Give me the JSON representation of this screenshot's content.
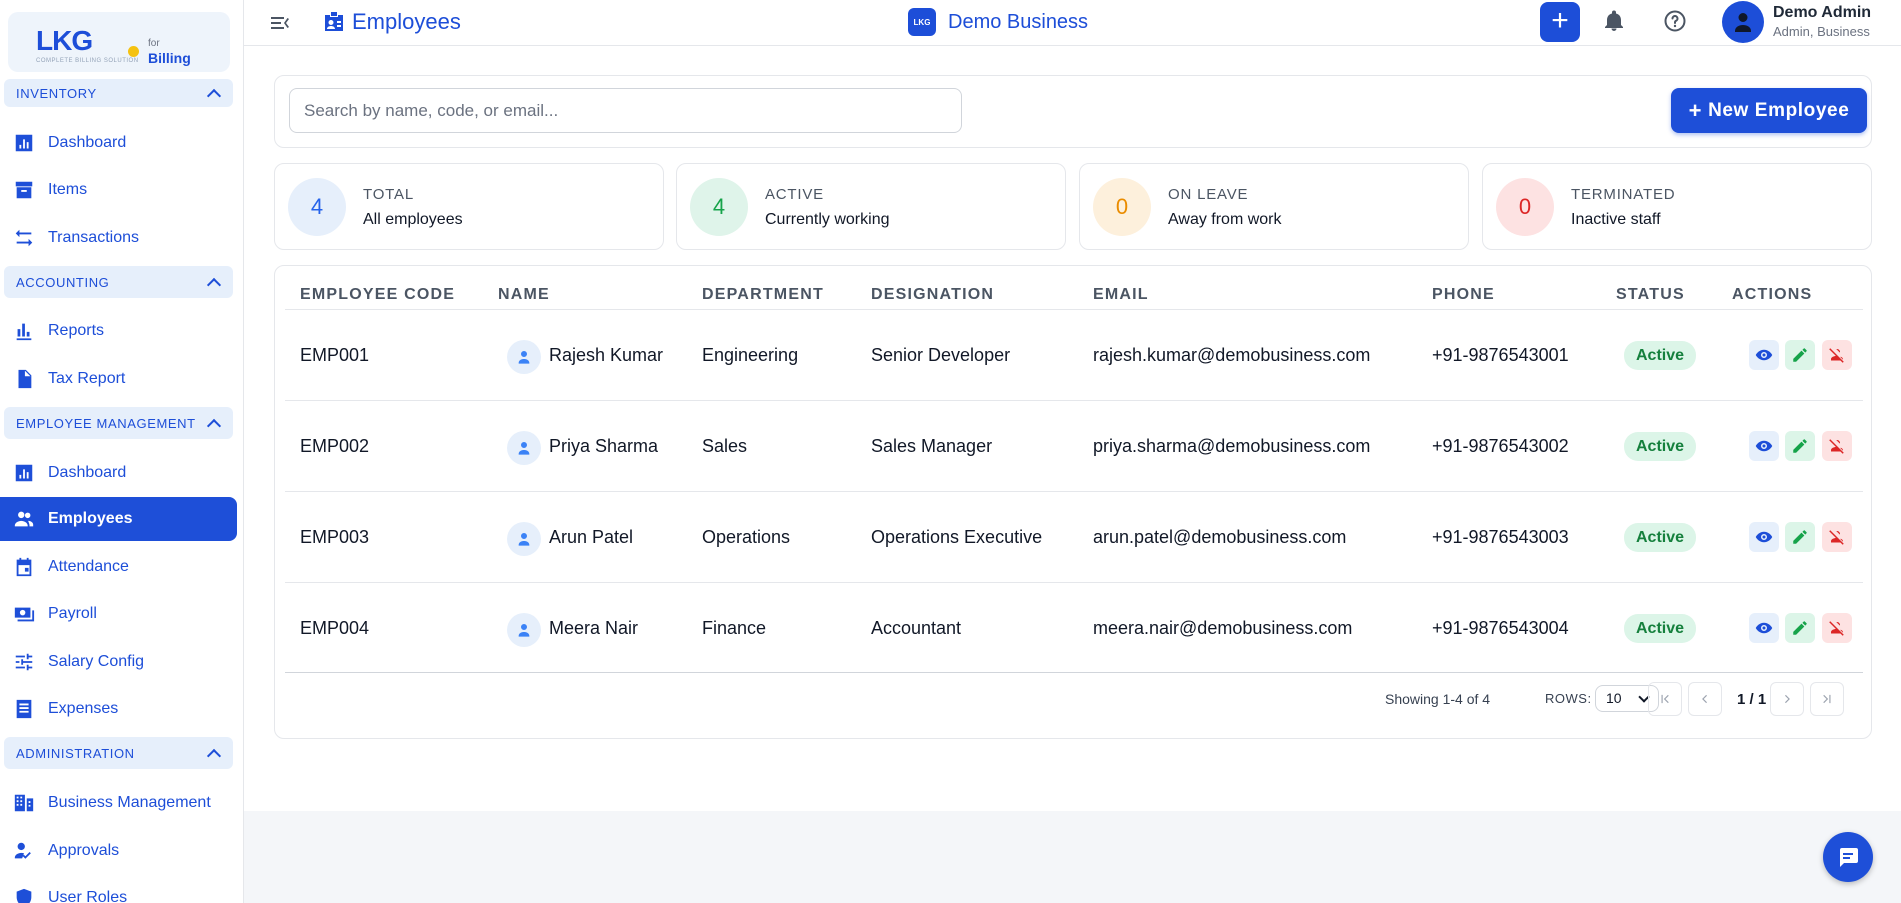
{
  "brand": {
    "logo_text": "LKG",
    "tagline": "COMPLETE BILLING SOLUTION",
    "for": "for",
    "product": "Billing"
  },
  "sidebar": {
    "sections": [
      {
        "label": "INVENTORY"
      },
      {
        "label": "ACCOUNTING"
      },
      {
        "label": "EMPLOYEE MANAGEMENT"
      },
      {
        "label": "ADMINISTRATION"
      }
    ],
    "items": [
      {
        "label": "Dashboard",
        "icon": "chart-icon"
      },
      {
        "label": "Items",
        "icon": "archive-icon"
      },
      {
        "label": "Transactions",
        "icon": "swap-icon"
      },
      {
        "label": "Reports",
        "icon": "bar-chart-icon"
      },
      {
        "label": "Tax Report",
        "icon": "document-icon"
      },
      {
        "label": "Dashboard",
        "icon": "dashboard-icon"
      },
      {
        "label": "Employees",
        "icon": "people-icon",
        "active": true
      },
      {
        "label": "Attendance",
        "icon": "calendar-icon"
      },
      {
        "label": "Payroll",
        "icon": "payments-icon"
      },
      {
        "label": "Salary Config",
        "icon": "tune-icon"
      },
      {
        "label": "Expenses",
        "icon": "receipt-icon"
      },
      {
        "label": "Business Management",
        "icon": "building-icon"
      },
      {
        "label": "Approvals",
        "icon": "approval-icon"
      },
      {
        "label": "User Roles",
        "icon": "shield-icon"
      }
    ]
  },
  "header": {
    "title": "Employees",
    "business_logo": "LKG",
    "business_name": "Demo Business",
    "add_label": "+",
    "user_name": "Demo Admin",
    "user_role": "Admin, Business"
  },
  "search": {
    "placeholder": "Search by name, code, or email...",
    "value": ""
  },
  "new_employee_button": {
    "plus": "+",
    "label": "New Employee"
  },
  "stats": [
    {
      "value": "4",
      "label": "TOTAL",
      "sub": "All employees",
      "color": "#2563eb",
      "bg": "#e6effb"
    },
    {
      "value": "4",
      "label": "ACTIVE",
      "sub": "Currently working",
      "color": "#16a34a",
      "bg": "#dff4ea"
    },
    {
      "value": "0",
      "label": "ON LEAVE",
      "sub": "Away from work",
      "color": "#ea8c00",
      "bg": "#fdf0dc"
    },
    {
      "value": "0",
      "label": "TERMINATED",
      "sub": "Inactive staff",
      "color": "#dc2626",
      "bg": "#fde2e2"
    }
  ],
  "table": {
    "headers": [
      "EMPLOYEE CODE",
      "NAME",
      "DEPARTMENT",
      "DESIGNATION",
      "EMAIL",
      "PHONE",
      "STATUS",
      "ACTIONS"
    ],
    "rows": [
      {
        "code": "EMP001",
        "name": "Rajesh Kumar",
        "department": "Engineering",
        "designation": "Senior Developer",
        "email": "rajesh.kumar@demobusiness.com",
        "phone": "+91-9876543001",
        "status": "Active"
      },
      {
        "code": "EMP002",
        "name": "Priya Sharma",
        "department": "Sales",
        "designation": "Sales Manager",
        "email": "priya.sharma@demobusiness.com",
        "phone": "+91-9876543002",
        "status": "Active"
      },
      {
        "code": "EMP003",
        "name": "Arun Patel",
        "department": "Operations",
        "designation": "Operations Executive",
        "email": "arun.patel@demobusiness.com",
        "phone": "+91-9876543003",
        "status": "Active"
      },
      {
        "code": "EMP004",
        "name": "Meera Nair",
        "department": "Finance",
        "designation": "Accountant",
        "email": "meera.nair@demobusiness.com",
        "phone": "+91-9876543004",
        "status": "Active"
      }
    ]
  },
  "pagination": {
    "showing": "Showing 1-4 of 4",
    "rows_label": "ROWS:",
    "rows_value": "10",
    "page": "1 / 1"
  }
}
